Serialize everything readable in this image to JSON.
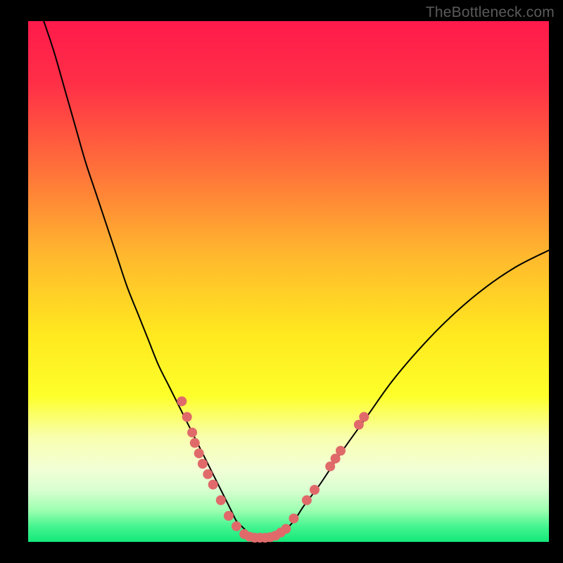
{
  "watermark": "TheBottleneck.com",
  "chart_data": {
    "type": "line",
    "title": "",
    "xlabel": "",
    "ylabel": "",
    "xlim": [
      0,
      100
    ],
    "ylim": [
      0,
      100
    ],
    "background_gradient": {
      "stops": [
        {
          "offset": 0.0,
          "color": "#ff1a4b"
        },
        {
          "offset": 0.12,
          "color": "#ff2f47"
        },
        {
          "offset": 0.28,
          "color": "#ff6f3a"
        },
        {
          "offset": 0.45,
          "color": "#ffb82e"
        },
        {
          "offset": 0.6,
          "color": "#ffe81f"
        },
        {
          "offset": 0.72,
          "color": "#fdff2a"
        },
        {
          "offset": 0.8,
          "color": "#f8ffb0"
        },
        {
          "offset": 0.86,
          "color": "#f2ffd6"
        },
        {
          "offset": 0.9,
          "color": "#d9ffd0"
        },
        {
          "offset": 0.94,
          "color": "#9cffb0"
        },
        {
          "offset": 0.97,
          "color": "#45f58f"
        },
        {
          "offset": 1.0,
          "color": "#14e87a"
        }
      ]
    },
    "series": [
      {
        "name": "bottleneck-curve",
        "color": "#000000",
        "stroke_width": 2,
        "x": [
          3,
          5,
          7,
          9,
          11,
          13,
          15,
          17,
          19,
          21,
          23,
          25,
          27,
          29,
          31,
          33,
          34,
          35,
          36,
          37,
          38,
          39,
          40,
          41,
          42,
          43,
          44,
          45,
          47,
          49,
          51,
          53,
          56,
          60,
          65,
          70,
          76,
          82,
          88,
          94,
          100
        ],
        "y": [
          100,
          94,
          87,
          80,
          73,
          67,
          61,
          55,
          49,
          44,
          39,
          34,
          30,
          26,
          22,
          18,
          16,
          14,
          12,
          10,
          8,
          6,
          4,
          3,
          2,
          1,
          0.5,
          0.5,
          0.8,
          2,
          4,
          7,
          11,
          17,
          24,
          31,
          38,
          44,
          49,
          53,
          56
        ]
      }
    ],
    "scatter": {
      "name": "sample-dots",
      "color": "#e06a6a",
      "radius": 7,
      "points": [
        {
          "x": 29.5,
          "y": 27
        },
        {
          "x": 30.5,
          "y": 24
        },
        {
          "x": 31.5,
          "y": 21
        },
        {
          "x": 32.0,
          "y": 19
        },
        {
          "x": 32.8,
          "y": 17
        },
        {
          "x": 33.5,
          "y": 15
        },
        {
          "x": 34.5,
          "y": 13
        },
        {
          "x": 35.5,
          "y": 11
        },
        {
          "x": 37.0,
          "y": 8
        },
        {
          "x": 38.5,
          "y": 5
        },
        {
          "x": 40.0,
          "y": 3
        },
        {
          "x": 41.5,
          "y": 1.5
        },
        {
          "x": 42.5,
          "y": 1
        },
        {
          "x": 43.5,
          "y": 0.8
        },
        {
          "x": 44.5,
          "y": 0.8
        },
        {
          "x": 45.5,
          "y": 0.8
        },
        {
          "x": 46.5,
          "y": 0.9
        },
        {
          "x": 47.5,
          "y": 1.2
        },
        {
          "x": 48.5,
          "y": 1.8
        },
        {
          "x": 49.5,
          "y": 2.5
        },
        {
          "x": 51.0,
          "y": 4.5
        },
        {
          "x": 53.5,
          "y": 8
        },
        {
          "x": 55.0,
          "y": 10
        },
        {
          "x": 58.0,
          "y": 14.5
        },
        {
          "x": 59.0,
          "y": 16
        },
        {
          "x": 60.0,
          "y": 17.5
        },
        {
          "x": 63.5,
          "y": 22.5
        },
        {
          "x": 64.5,
          "y": 24
        }
      ]
    }
  }
}
